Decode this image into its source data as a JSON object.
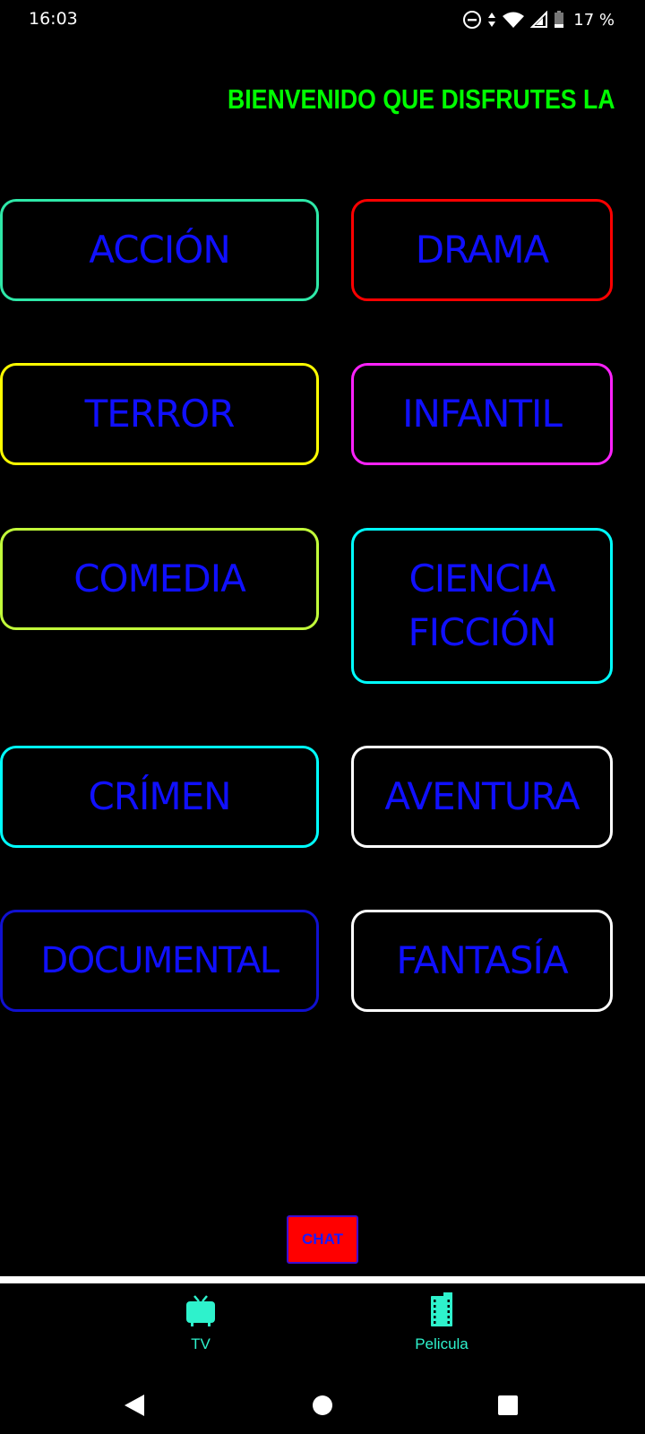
{
  "status_bar": {
    "time": "16:03",
    "battery": "17 %",
    "icons": [
      "do-not-disturb-icon",
      "data-arrows-icon",
      "wifi-icon",
      "signal-icon",
      "battery-icon"
    ]
  },
  "marquee": {
    "text": "BIENVENIDO QUE DISFRUTES LA"
  },
  "genres": [
    {
      "label": "ACCIÓN",
      "border_color": "#2ee8a8"
    },
    {
      "label": "DRAMA",
      "border_color": "#ff0000"
    },
    {
      "label": "TERROR",
      "border_color": "#ffff00"
    },
    {
      "label": "INFANTIL",
      "border_color": "#ff22ff"
    },
    {
      "label": "COMEDIA",
      "border_color": "#c2ff3a"
    },
    {
      "label": "CIENCIA FICCIÓN",
      "border_color": "#00ffff"
    },
    {
      "label": "CRÍMEN",
      "border_color": "#00ffff"
    },
    {
      "label": "AVENTURA",
      "border_color": "#ffffff"
    },
    {
      "label": "DOCUMENTAL",
      "border_color": "#1010d0"
    },
    {
      "label": "FANTASÍA",
      "border_color": "#ffffff"
    }
  ],
  "chat_button": {
    "label": "CHAT",
    "background": "#ff0000"
  },
  "bottom_nav": {
    "items": [
      {
        "label": "TV",
        "icon": "tv-icon"
      },
      {
        "label": "Pelicula",
        "icon": "film-icon"
      }
    ],
    "accent": "#2ef2cc"
  },
  "system_nav": {
    "icons": [
      "back-icon",
      "home-icon",
      "recents-icon"
    ]
  }
}
